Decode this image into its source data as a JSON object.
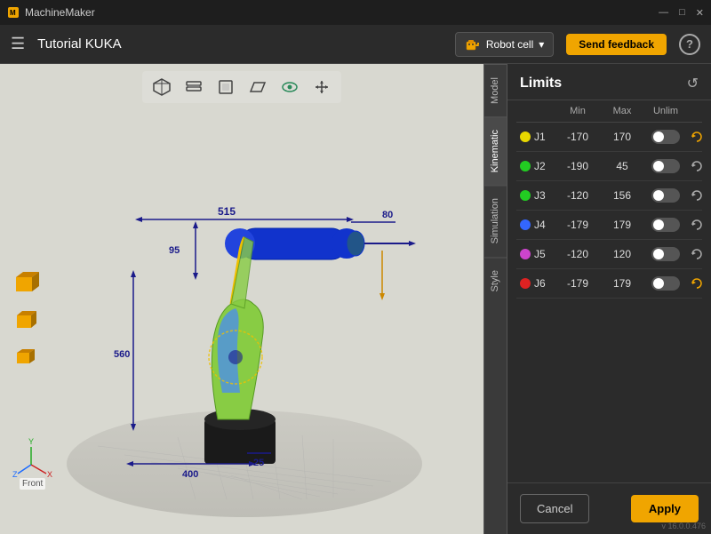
{
  "titlebar": {
    "title": "MachineMaker",
    "controls": [
      "—",
      "□",
      "✕"
    ]
  },
  "topbar": {
    "menu_icon": "☰",
    "app_title": "Tutorial KUKA",
    "robot_cell_label": "Robot cell",
    "chevron": "▾",
    "feedback_label": "Send feedback",
    "help_label": "?"
  },
  "viewport": {
    "toolbar_icons": [
      "box3d",
      "layers",
      "cube",
      "parallelogram",
      "eye",
      "arrows"
    ],
    "dimensions": {
      "top": "515",
      "right_top": "80",
      "left_mid": "95",
      "left_bottom": "560",
      "bottom": "400",
      "bottom2": "25"
    }
  },
  "tabs": [
    {
      "id": "model",
      "label": "Model"
    },
    {
      "id": "kinematic",
      "label": "Kinematic",
      "active": true
    },
    {
      "id": "simulation",
      "label": "Simulation"
    },
    {
      "id": "style",
      "label": "Style"
    }
  ],
  "panel": {
    "title": "Limits",
    "refresh_icon": "↺",
    "headers": [
      "",
      "Min",
      "Max",
      "Unlim",
      "",
      ""
    ],
    "joints": [
      {
        "id": "J1",
        "color": "#e8d800",
        "min": "-170",
        "max": "170",
        "unlim": false,
        "has_reset": true
      },
      {
        "id": "J2",
        "color": "#22cc22",
        "min": "-190",
        "max": "45",
        "unlim": false,
        "has_reset": false
      },
      {
        "id": "J3",
        "color": "#22cc22",
        "min": "-120",
        "max": "156",
        "unlim": false,
        "has_reset": false
      },
      {
        "id": "J4",
        "color": "#3366ff",
        "min": "-179",
        "max": "179",
        "unlim": false,
        "has_reset": false
      },
      {
        "id": "J5",
        "color": "#cc44cc",
        "min": "-120",
        "max": "120",
        "unlim": false,
        "has_reset": false
      },
      {
        "id": "J6",
        "color": "#dd2222",
        "min": "-179",
        "max": "179",
        "unlim": false,
        "has_reset": true
      }
    ],
    "cancel_label": "Cancel",
    "apply_label": "Apply",
    "version": "v 16.0.0.476"
  }
}
